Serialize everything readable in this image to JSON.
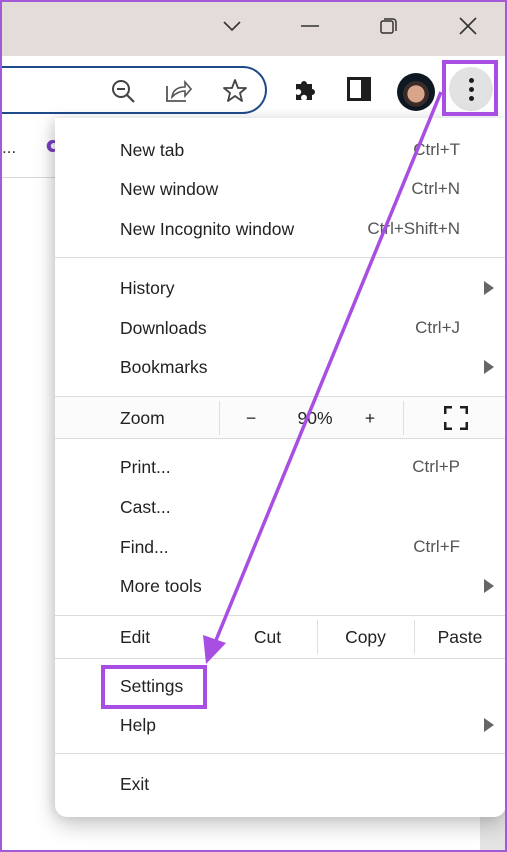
{
  "window": {
    "controls": [
      {
        "name": "tab-search",
        "icon": "chevron-down-icon"
      },
      {
        "name": "minimize",
        "icon": "minimize-icon"
      },
      {
        "name": "restore",
        "icon": "restore-icon"
      },
      {
        "name": "close",
        "icon": "close-icon"
      }
    ]
  },
  "toolbar": {
    "omnibox_icons": [
      "zoom-out-icon",
      "share-icon",
      "bookmark-star-icon"
    ],
    "extensions_icon": "puzzle-icon",
    "side_panel_icon": "side-panel-icon",
    "profile_icon": "avatar",
    "menu_icon": "kebab-menu-icon"
  },
  "bookmarks_bar": {
    "overflow_text": "..."
  },
  "menu": {
    "group1": [
      {
        "label": "New tab",
        "shortcut": "Ctrl+T"
      },
      {
        "label": "New window",
        "shortcut": "Ctrl+N"
      },
      {
        "label": "New Incognito window",
        "shortcut": "Ctrl+Shift+N"
      }
    ],
    "group2": [
      {
        "label": "History",
        "submenu": true
      },
      {
        "label": "Downloads",
        "shortcut": "Ctrl+J"
      },
      {
        "label": "Bookmarks",
        "submenu": true
      }
    ],
    "zoom": {
      "label": "Zoom",
      "minus": "−",
      "value": "90%",
      "plus": "+",
      "fullscreen_icon": "fullscreen-icon"
    },
    "group3": [
      {
        "label": "Print...",
        "shortcut": "Ctrl+P"
      },
      {
        "label": "Cast..."
      },
      {
        "label": "Find...",
        "shortcut": "Ctrl+F"
      },
      {
        "label": "More tools",
        "submenu": true
      }
    ],
    "edit": {
      "label": "Edit",
      "cut": "Cut",
      "copy": "Copy",
      "paste": "Paste"
    },
    "group4": [
      {
        "label": "Settings"
      },
      {
        "label": "Help",
        "submenu": true
      }
    ],
    "exit": {
      "label": "Exit"
    }
  },
  "annotation": {
    "color": "#a94ee2",
    "highlights": [
      "menu-button",
      "settings"
    ]
  }
}
